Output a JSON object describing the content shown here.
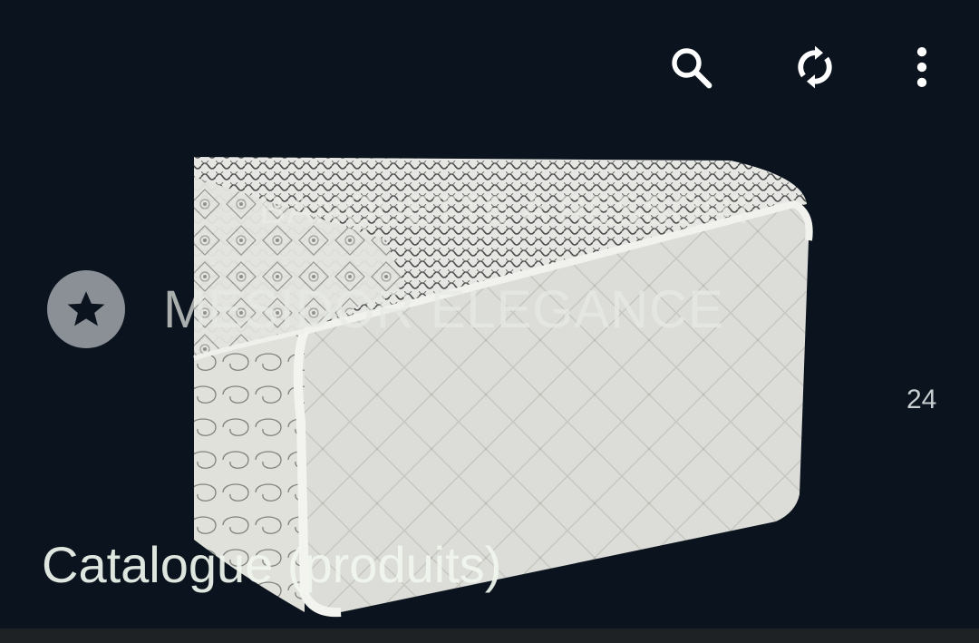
{
  "toolbar": {
    "search_icon": "search-icon",
    "sync_icon": "sync-icon",
    "more_icon": "more-vert-icon"
  },
  "product": {
    "category": "BANQUETTE A RESSORT",
    "name": "MESIDOR ELEGANCE",
    "favorite_icon": "star-icon",
    "count": "24"
  },
  "section": {
    "title": "Catalogue (produits)"
  },
  "colors": {
    "background": "#0b141e",
    "accent_icon": "#ffffff",
    "star_circle": "#8a9096"
  }
}
